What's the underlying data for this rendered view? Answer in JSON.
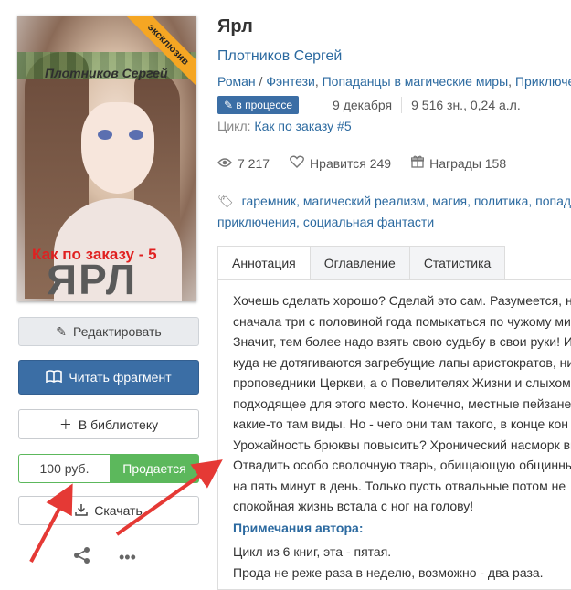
{
  "cover": {
    "author_text": "Плотников Сергей",
    "series_text": "Как по заказу - 5",
    "title_text": "ЯРЛ",
    "ribbon": "эксклюзив"
  },
  "actions": {
    "edit": "Редактировать",
    "read": "Читать фрагмент",
    "library": "В библиотеку",
    "price": "100 руб.",
    "sell": "Продается",
    "download": "Скачать"
  },
  "book": {
    "title": "Ярл",
    "author": "Плотников Сергей",
    "genres": [
      "Роман",
      "Фэнтези",
      "Попаданцы в магические миры",
      "Приключе"
    ],
    "status": "в процессе",
    "date": "9 декабря",
    "size": "9 516 зн., 0,24 а.л.",
    "cycle_label": "Цикл:",
    "cycle_name": "Как по заказу #5"
  },
  "stats": {
    "views": "7 217",
    "likes": "Нравится 249",
    "awards": "Награды 158"
  },
  "tags": {
    "line1": [
      "гаремник",
      "магический реализм",
      "магия",
      "политика",
      "попад"
    ],
    "line2": [
      "приключения",
      "социальная фантасти"
    ]
  },
  "tabs": [
    "Аннотация",
    "Оглавление",
    "Статистика"
  ],
  "annotation": [
    "Хочешь сделать хорошо? Сделай это сам. Разумеется, ну",
    "сначала три с половиной года помыкаться по чужому ми",
    "Значит, тем более надо взять свою судьбу в свои руки! И",
    "куда не дотягиваются загребущие лапы аристократов, ни",
    "проповедники Церкви, а о Повелителях Жизни и слыхом",
    "подходящее для этого место. Конечно, местные пейзане",
    "какие-то там виды. Но - чего они там такого, в конце кон",
    "Урожайность брюквы повысить? Хронический насморк вы",
    "Отвадить особо сволочную тварь, обищающую общинны",
    "на пять минут в день. Только пусть отвальные потом не",
    "спокойная жизнь встала с ног на голову!"
  ],
  "notes": {
    "title": "Примечания автора:",
    "lines": [
      "Цикл из 6 книг, эта - пятая.",
      "Прода не реже раза в неделю, возможно - два раза."
    ]
  },
  "colors": {
    "accent": "#3b6ea5",
    "sell": "#5cb85c",
    "link": "#2c6aa0",
    "arrow": "#e53935"
  }
}
